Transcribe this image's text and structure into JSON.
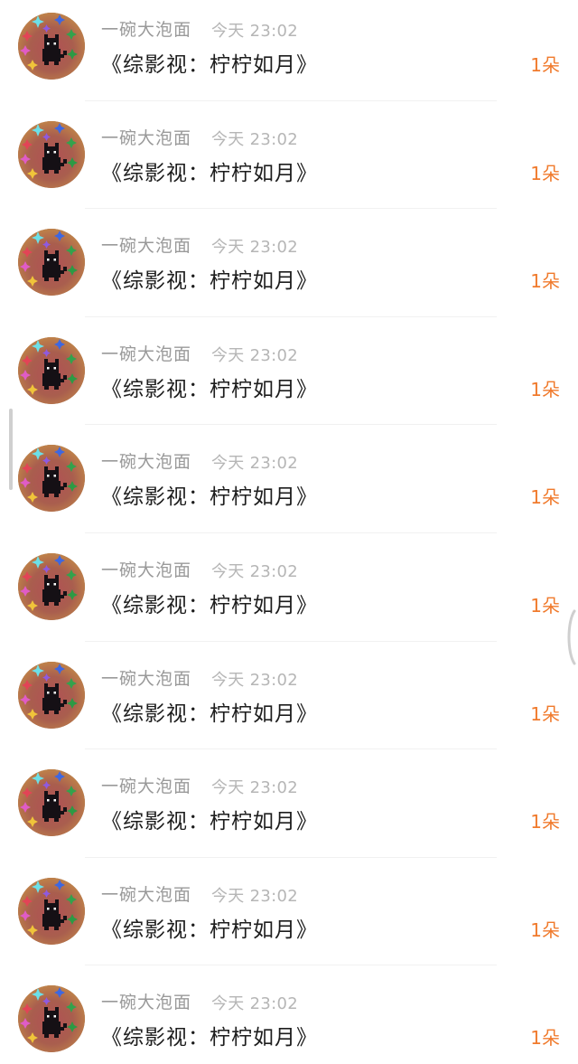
{
  "items": [
    {
      "user": "一碗大泡面",
      "time": "今天 23:02",
      "title": "《综影视：柠柠如月》",
      "count": "1朵"
    },
    {
      "user": "一碗大泡面",
      "time": "今天 23:02",
      "title": "《综影视：柠柠如月》",
      "count": "1朵"
    },
    {
      "user": "一碗大泡面",
      "time": "今天 23:02",
      "title": "《综影视：柠柠如月》",
      "count": "1朵"
    },
    {
      "user": "一碗大泡面",
      "time": "今天 23:02",
      "title": "《综影视：柠柠如月》",
      "count": "1朵"
    },
    {
      "user": "一碗大泡面",
      "time": "今天 23:02",
      "title": "《综影视：柠柠如月》",
      "count": "1朵"
    },
    {
      "user": "一碗大泡面",
      "time": "今天 23:02",
      "title": "《综影视：柠柠如月》",
      "count": "1朵"
    },
    {
      "user": "一碗大泡面",
      "time": "今天 23:02",
      "title": "《综影视：柠柠如月》",
      "count": "1朵"
    },
    {
      "user": "一碗大泡面",
      "time": "今天 23:02",
      "title": "《综影视：柠柠如月》",
      "count": "1朵"
    },
    {
      "user": "一碗大泡面",
      "time": "今天 23:02",
      "title": "《综影视：柠柠如月》",
      "count": "1朵"
    },
    {
      "user": "一碗大泡面",
      "time": "今天 23:02",
      "title": "《综影视：柠柠如月》",
      "count": "1朵"
    }
  ],
  "colors": {
    "count_accent": "#f07a2c",
    "username": "#9a9a9a",
    "time": "#b6b6b6",
    "title": "#1d1d1d"
  },
  "icons": {
    "avatar": "black-cat-sparkles-avatar",
    "scrollbar": "scrollbar-thumb",
    "edge_handle": "side-swipe-handle"
  }
}
